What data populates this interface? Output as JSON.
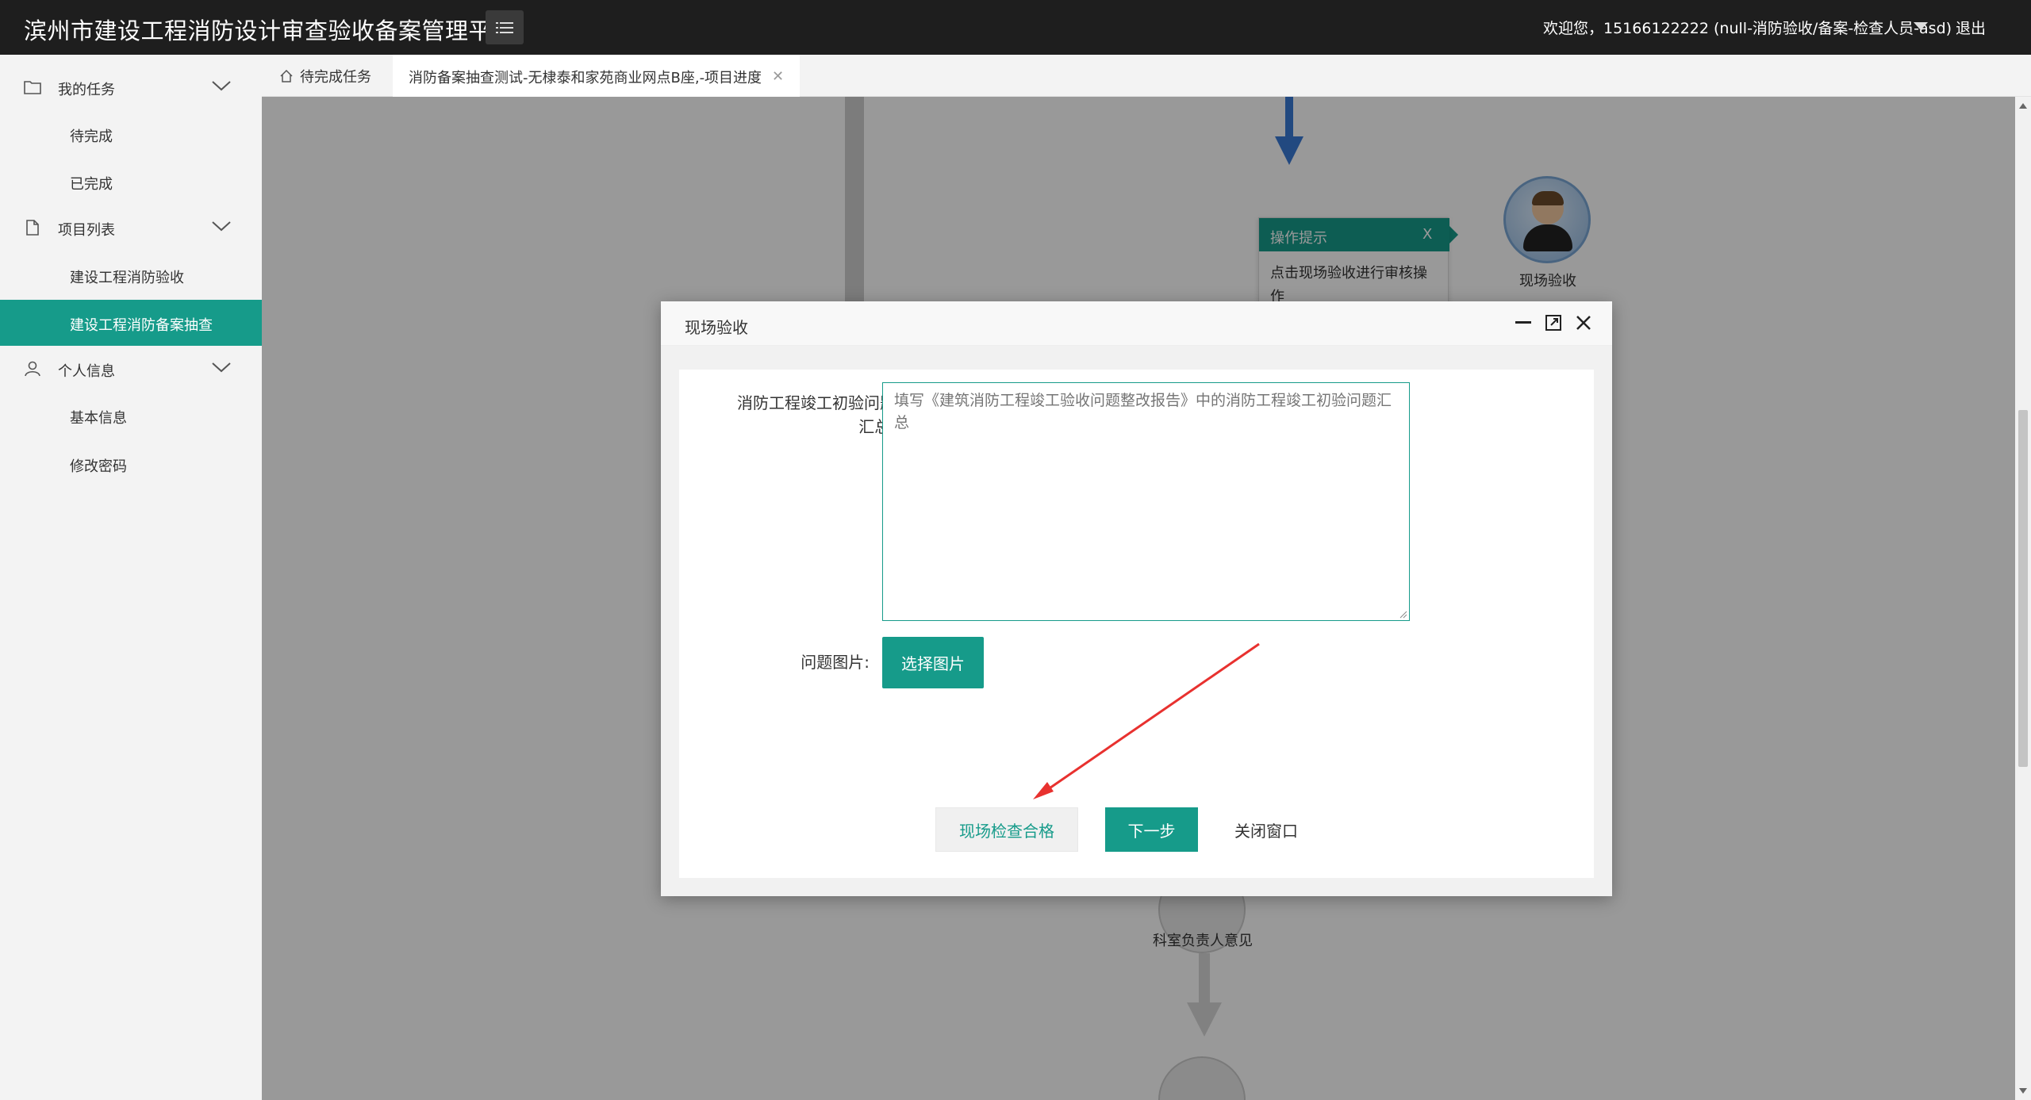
{
  "header": {
    "title": "滨州市建设工程消防设计审查验收备案管理平台",
    "welcome": "欢迎您，15166122222 (null-消防验收/备案-检查人员-asd)",
    "logout": "退出"
  },
  "sidebar": {
    "groups": [
      {
        "label": "我的任务",
        "icon": "folder-icon",
        "items": [
          "待完成",
          "已完成"
        ]
      },
      {
        "label": "项目列表",
        "icon": "file-icon",
        "items": [
          "建设工程消防验收",
          "建设工程消防备案抽查"
        ]
      },
      {
        "label": "个人信息",
        "icon": "user-icon",
        "items": [
          "基本信息",
          "修改密码"
        ]
      }
    ],
    "active_item": "建设工程消防备案抽查"
  },
  "tabs": {
    "home": "待完成任务",
    "active": "消防备案抽查测试-无棣泰和家苑商业网点B座,-项目进度"
  },
  "flow": {
    "node_top_label": "现场验收",
    "node_bottom_label": "科室负责人意见",
    "tip": {
      "title": "操作提示",
      "close": "X",
      "body": "点击现场验收进行审核操作"
    }
  },
  "modal": {
    "title": "现场验收",
    "field_label": "消防工程竣工初验问题汇总:",
    "textarea_placeholder": "填写《建筑消防工程竣工验收问题整改报告》中的消防工程竣工初验问题汇总",
    "image_label": "问题图片:",
    "pick_button": "选择图片",
    "pass_button": "现场检查合格",
    "next_button": "下一步",
    "close_button": "关闭窗口"
  },
  "colors": {
    "accent": "#169b8a",
    "topbar": "#1e1e1e",
    "annotation": "#e8312f"
  }
}
